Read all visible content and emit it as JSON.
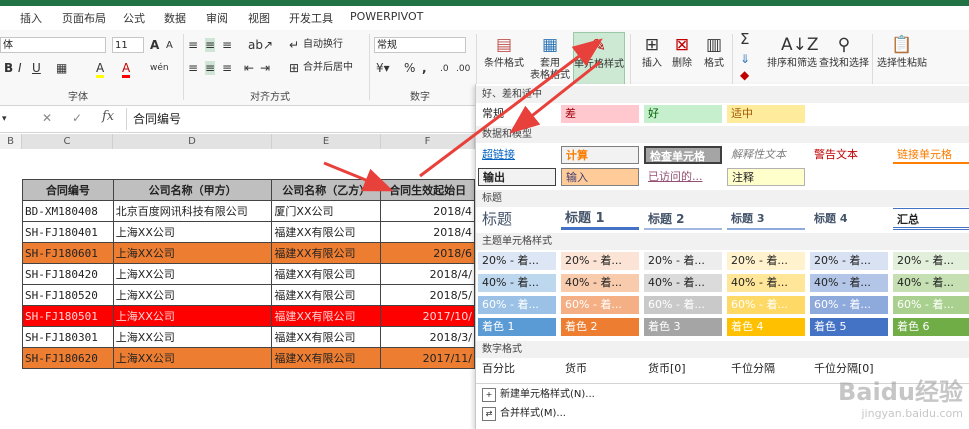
{
  "ribbon_tabs": [
    "插入",
    "页面布局",
    "公式",
    "数据",
    "审阅",
    "视图",
    "开发工具",
    "POWERPIVOT"
  ],
  "font": {
    "name": "体",
    "size": "11",
    "label": "字体",
    "grow": "A",
    "shrink": "A",
    "bold": "B",
    "italic": "I",
    "underline": "U",
    "fill_letter": "A",
    "font_color_letter": "A"
  },
  "alignment": {
    "wrap": "自动换行",
    "merge": "合并后居中",
    "label": "对齐方式"
  },
  "number": {
    "format": "常规",
    "label": "数字",
    "percent": "%",
    "comma": ",",
    "dec_inc": ".0",
    "dec_dec": ".00"
  },
  "styles_group": {
    "conditional": "条件格式",
    "table_line1": "套用",
    "table_line2": "表格格式",
    "cell_styles": "单元格样式"
  },
  "cells_group": {
    "insert": "插入",
    "delete": "删除",
    "format": "格式"
  },
  "editing": {
    "sum": "Σ",
    "sort": "排序和筛选",
    "find": "查找和选择",
    "paste": "选择性粘贴"
  },
  "formula_bar": {
    "fx": "fx",
    "value": "合同编号",
    "cancel": "✕",
    "enter": "✓"
  },
  "columns": [
    "B",
    "C",
    "D",
    "E",
    "F"
  ],
  "table": {
    "headers": [
      "合同编号",
      "公司名称（甲方）",
      "公司名称（乙方）",
      "合同生效起始日"
    ],
    "rows": [
      {
        "id": "BD-XM180408",
        "party_a": "北京百度网讯科技有限公司",
        "party_b": "厦门XX公司",
        "date": "2018/4",
        "style": "plain"
      },
      {
        "id": "SH-FJ180401",
        "party_a": "上海XX公司",
        "party_b": "福建XX有限公司",
        "date": "2018/4",
        "style": "plain"
      },
      {
        "id": "SH-FJ180601",
        "party_a": "上海XX公司",
        "party_b": "福建XX有限公司",
        "date": "2018/6",
        "style": "orange"
      },
      {
        "id": "SH-FJ180420",
        "party_a": "上海XX公司",
        "party_b": "福建XX有限公司",
        "date": "2018/4/",
        "style": "plain"
      },
      {
        "id": "SH-FJ180520",
        "party_a": "上海XX公司",
        "party_b": "福建XX有限公司",
        "date": "2018/5/",
        "style": "plain"
      },
      {
        "id": "SH-FJ180501",
        "party_a": "上海XX公司",
        "party_b": "福建XX有限公司",
        "date": "2017/10/",
        "style": "red"
      },
      {
        "id": "SH-FJ180301",
        "party_a": "上海XX公司",
        "party_b": "福建XX有限公司",
        "date": "2018/3/",
        "style": "plain"
      },
      {
        "id": "SH-FJ180620",
        "party_a": "上海XX公司",
        "party_b": "福建XX有限公司",
        "date": "2017/11/",
        "style": "orange"
      }
    ]
  },
  "gallery": {
    "sec_good_bad": "好、差和适中",
    "normal": "常规",
    "bad": "差",
    "good": "好",
    "neutral": "适中",
    "sec_data_model": "数据和模型",
    "hyperlink": "超链接",
    "calc": "计算",
    "check": "检查单元格",
    "explanatory": "解释性文本",
    "warning": "警告文本",
    "linked": "链接单元格",
    "output": "输出",
    "input": "输入",
    "visited": "已访问的...",
    "note": "注释",
    "sec_titles": "标题",
    "title": "标题",
    "h1": "标题 1",
    "h2": "标题 2",
    "h3": "标题 3",
    "h4": "标题 4",
    "total": "汇总",
    "sec_theme": "主题单元格样式",
    "pct20": "20% - 着...",
    "pct40": "40% - 着...",
    "pct60": "60% - 着...",
    "accents": [
      "着色 1",
      "着色 2",
      "着色 3",
      "着色 4",
      "着色 5",
      "着色 6"
    ],
    "sec_number": "数字格式",
    "numfmt": [
      "百分比",
      "货币",
      "货币[0]",
      "千位分隔",
      "千位分隔[0]"
    ],
    "new_style": "新建单元格样式(N)...",
    "merge_styles": "合并样式(M)..."
  },
  "colors": {
    "excel_green": "#217346",
    "arrow_red": "#e8403a",
    "row_orange": "#ed7d31",
    "row_red": "#ff0000",
    "header_gray": "#bfbfbf"
  },
  "watermark": {
    "line1": "Baidu经验",
    "line2": "jingyan.baidu.com"
  }
}
